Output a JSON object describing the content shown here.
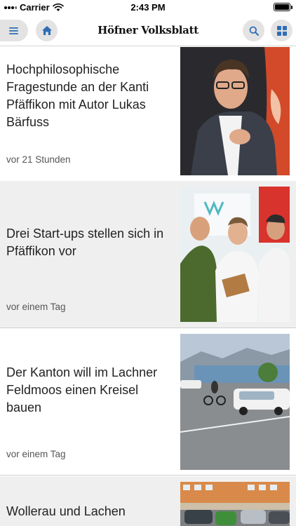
{
  "status_bar": {
    "carrier": "Carrier",
    "time": "2:43 PM",
    "battery_level": 1.0
  },
  "nav": {
    "logo": "Höfner Volksblatt",
    "icons": [
      "menu-icon",
      "home-icon",
      "search-icon",
      "grid-icon"
    ],
    "accent_color": "#2f6db5"
  },
  "articles": [
    {
      "title": "Hochphilosophische Fragestunde an der Kanti Pfäffikon mit Autor Lukas Bärfuss",
      "time": "vor 21 Stunden"
    },
    {
      "title": "Drei Start-ups stellen sich in Pfäffikon vor",
      "time": "vor einem Tag"
    },
    {
      "title": "Der Kanton will im Lachner Feldmoos einen Kreisel bauen",
      "time": "vor einem Tag"
    },
    {
      "title": "Wollerau und Lachen",
      "time": ""
    }
  ]
}
